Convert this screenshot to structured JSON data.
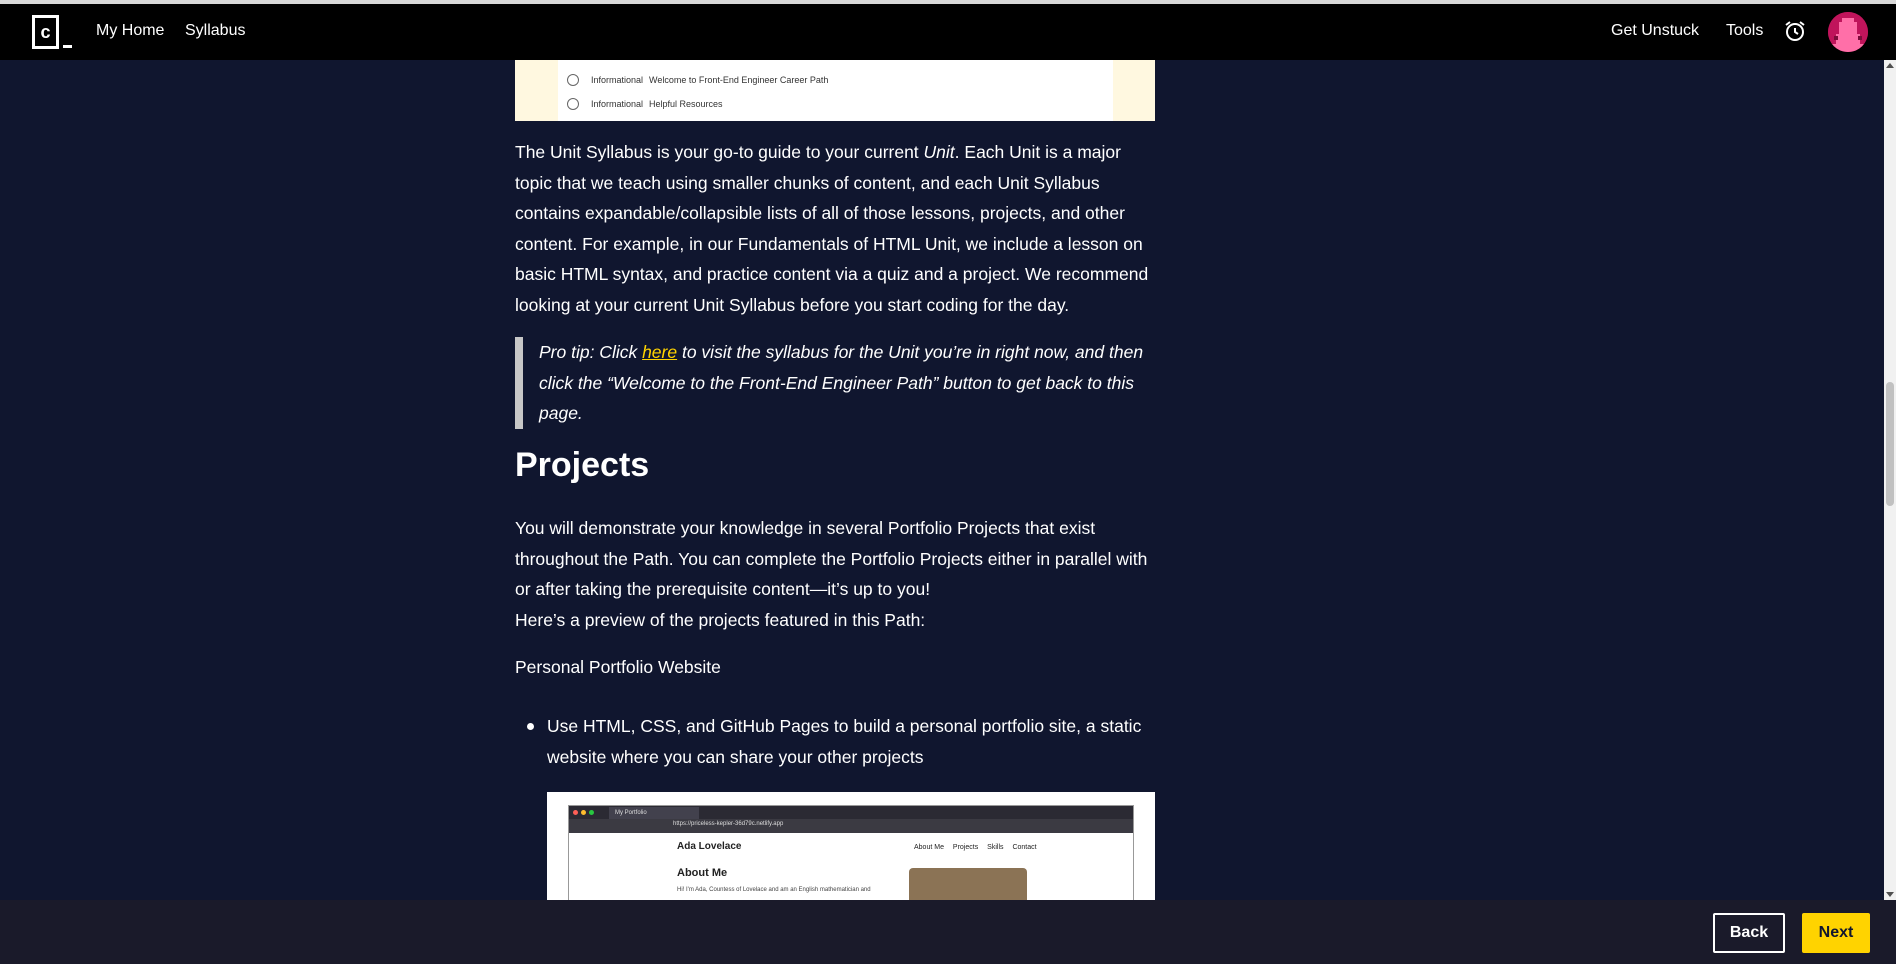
{
  "header": {
    "logo_text": "c",
    "nav": {
      "my_home": "My Home",
      "syllabus": "Syllabus"
    },
    "right": {
      "get_unstuck": "Get Unstuck",
      "tools": "Tools"
    },
    "icons": {
      "logo": "codecademy-logo",
      "alarm": "alarm-clock-icon",
      "avatar": "user-avatar"
    }
  },
  "syllabus_preview": {
    "rows": [
      {
        "kind": "Informational",
        "title": "Welcome to Front-End Engineer Career Path"
      },
      {
        "kind": "Informational",
        "title": "Helpful Resources"
      }
    ]
  },
  "article": {
    "unit_para_pre": "The Unit Syllabus is your go-to guide to your current ",
    "unit_para_em": "Unit",
    "unit_para_post": ". Each Unit is a major topic that we teach using smaller chunks of content, and each Unit Syllabus contains expandable/collapsible lists of all of those lessons, projects, and other content. For example, in our Fundamentals of HTML Unit, we include a lesson on basic HTML syntax, and practice content via a quiz and a project. We recommend looking at your current Unit Syllabus before you start coding for the day.",
    "tip_pre": "Pro tip: Click ",
    "tip_link": "here",
    "tip_post": " to visit the syllabus for the Unit you’re in right now, and then click the “Welcome to the Front-End Engineer Path” button to get back to this page.",
    "projects_heading": "Projects",
    "projects_para": "You will demonstrate your knowledge in several Portfolio Projects that exist throughout the Path. You can complete the Portfolio Projects either in parallel with or after taking the prerequisite content—it’s up to you!",
    "preview_para": "Here’s a preview of the projects featured in this Path:",
    "project_1_title": "Personal Portfolio Website",
    "project_1_bullet": "Use HTML, CSS, and GitHub Pages to build a personal portfolio site, a static website where you can share your other projects"
  },
  "portfolio_preview": {
    "tab_label": "My Portfolio",
    "url": "https://priceless-kepler-36d79c.netlify.app",
    "site_name": "Ada Lovelace",
    "site_nav": [
      "About Me",
      "Projects",
      "Skills",
      "Contact"
    ],
    "about_heading": "About Me",
    "about_text": "Hi! I'm Ada, Countess of Lovelace and am an English mathematician and"
  },
  "footer": {
    "back": "Back",
    "next": "Next"
  },
  "colors": {
    "background": "#10162f",
    "header": "#000000",
    "accent": "#ffd300",
    "avatar": "#c0145b"
  }
}
